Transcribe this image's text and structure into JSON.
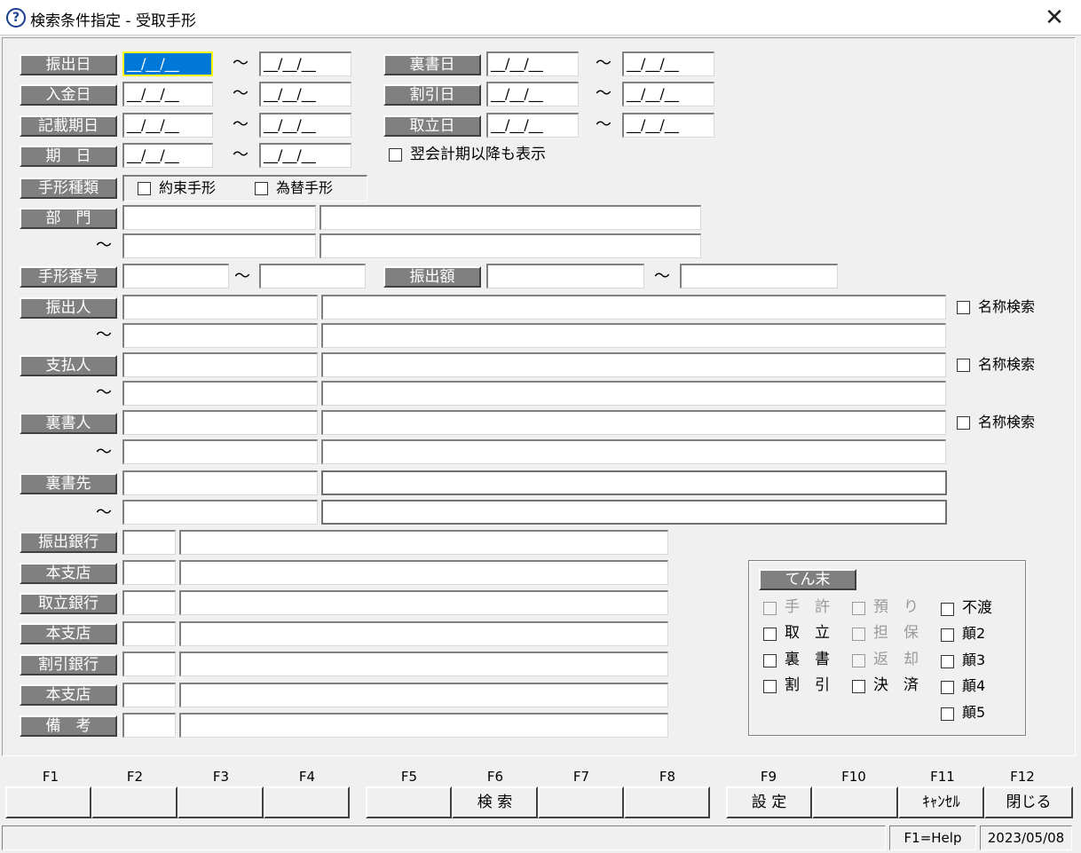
{
  "window": {
    "title": "検索条件指定 - 受取手形",
    "icon": "help-question-icon"
  },
  "date_placeholder": "__/__/__",
  "tilde": "～",
  "date_rows": [
    {
      "label": "振出日"
    },
    {
      "label": "入金日"
    },
    {
      "label": "記載期日"
    },
    {
      "label": "期　日"
    }
  ],
  "date_rows_right": [
    {
      "label": "裏書日"
    },
    {
      "label": "割引日"
    },
    {
      "label": "取立日"
    }
  ],
  "show_after_next_period": "翌会計期以降も表示",
  "note_type": {
    "label": "手形種類",
    "opt1": "約束手形",
    "opt2": "為替手形"
  },
  "department": {
    "label": "部　門"
  },
  "note_number": {
    "label": "手形番号"
  },
  "amount": {
    "label": "振出額"
  },
  "parties": [
    {
      "label": "振出人",
      "name_search": "名称検索"
    },
    {
      "label": "支払人",
      "name_search": "名称検索"
    },
    {
      "label": "裏書人",
      "name_search": "名称検索"
    },
    {
      "label": "裏書先"
    }
  ],
  "banks": [
    {
      "label": "振出銀行"
    },
    {
      "label": "本支店"
    },
    {
      "label": "取立銀行"
    },
    {
      "label": "本支店"
    },
    {
      "label": "割引銀行"
    },
    {
      "label": "本支店"
    },
    {
      "label": "備　考"
    }
  ],
  "tenmatsu": {
    "label": "てん末",
    "col1": [
      "手　許",
      "取　立",
      "裏　書",
      "割　引"
    ],
    "col2": [
      "預　り",
      "担　保",
      "返　却",
      "決　済"
    ],
    "col3": [
      "不渡",
      "顛2",
      "顛3",
      "顛4",
      "顛5"
    ]
  },
  "fkeys": [
    "F1",
    "F2",
    "F3",
    "F4",
    "F5",
    "F6",
    "F7",
    "F8",
    "F9",
    "F10",
    "F11",
    "F12"
  ],
  "fbuttons": [
    "",
    "",
    "",
    "",
    "",
    "検 索",
    "",
    "",
    "設 定",
    "",
    "ｷｬﾝｾﾙ",
    "閉じる"
  ],
  "status": {
    "help": "F1=Help",
    "date": "2023/05/08"
  }
}
